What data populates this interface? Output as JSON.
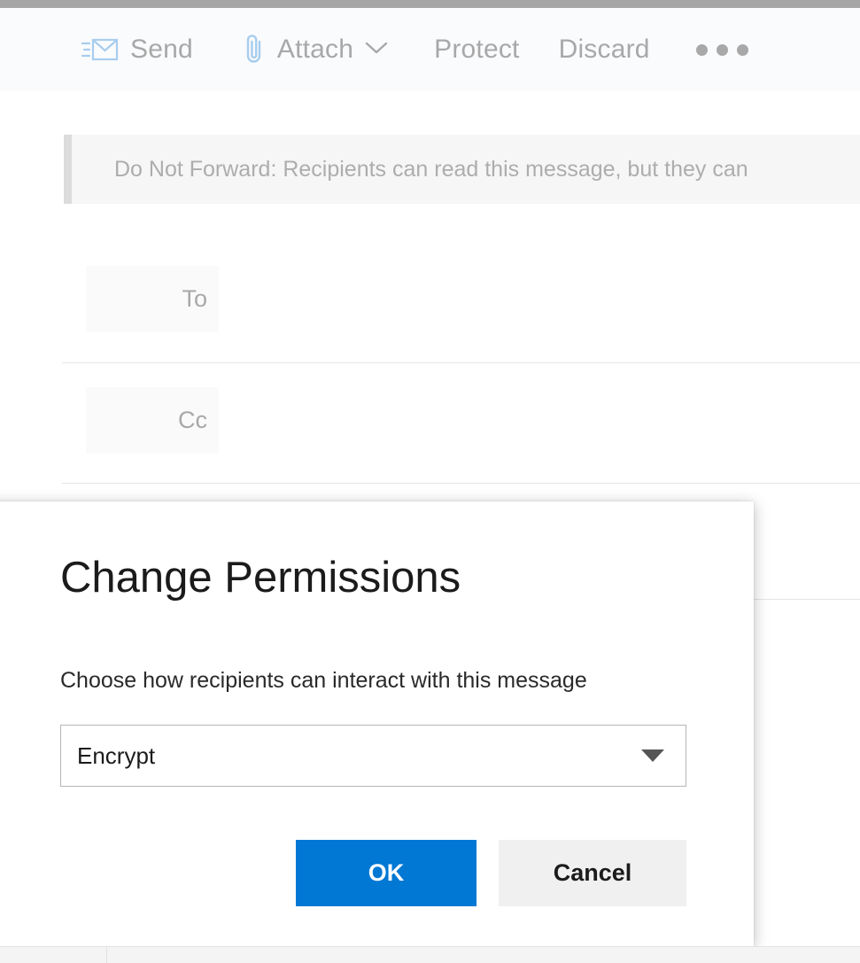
{
  "window": {
    "chrome_bar_color": "#a6a6a6"
  },
  "toolbar": {
    "background_color": "#fafbfd",
    "text_color": "#a8a8a8",
    "items": [
      {
        "id": "send",
        "label": "Send",
        "icon": "send-envelope-icon",
        "has_chevron": false
      },
      {
        "id": "attach",
        "label": "Attach",
        "icon": "paperclip-icon",
        "has_chevron": true
      },
      {
        "id": "protect",
        "label": "Protect",
        "icon": "",
        "has_chevron": false
      },
      {
        "id": "discard",
        "label": "Discard",
        "icon": "",
        "has_chevron": false
      }
    ],
    "overflow_label": "..."
  },
  "banner": {
    "text": "Do Not Forward: Recipients can read this message, but they can",
    "accent_color": "#dcdcdc",
    "background_color": "#f6f6f6"
  },
  "compose": {
    "fields": [
      {
        "id": "to",
        "label": "To",
        "value": ""
      },
      {
        "id": "cc",
        "label": "Cc",
        "value": ""
      }
    ]
  },
  "dialog": {
    "title": "Change Permissions",
    "subtitle": "Choose how recipients can interact with this message",
    "dropdown": {
      "selected": "Encrypt",
      "icon": "chevron-down-icon"
    },
    "buttons": {
      "ok": "OK",
      "cancel": "Cancel"
    },
    "accent_color": "#0078d4"
  }
}
